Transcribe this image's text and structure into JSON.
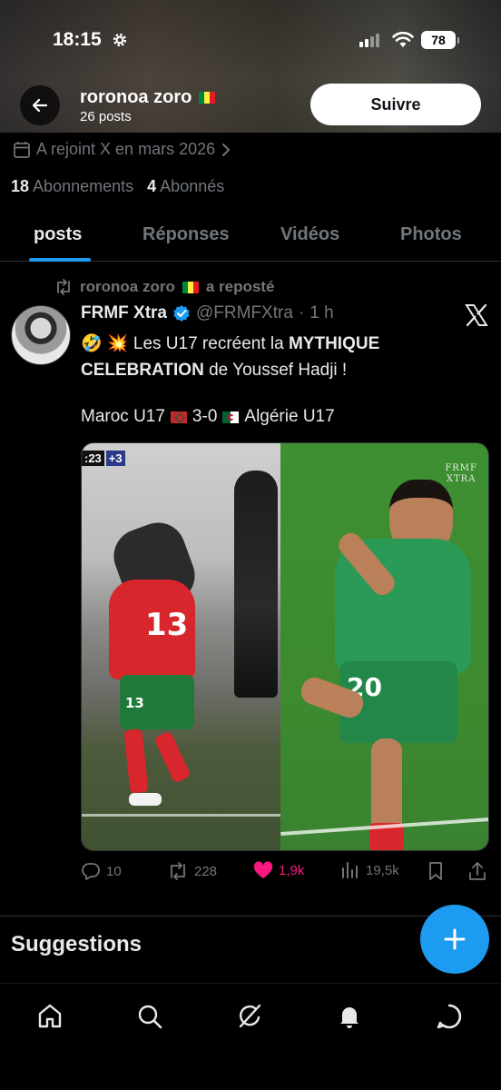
{
  "status_bar": {
    "time": "18:15",
    "battery": "78"
  },
  "header": {
    "name": "roronoa zoro",
    "posts_count": "26 posts",
    "follow_label": "Suivre"
  },
  "profile": {
    "joined": "A rejoint X en mars 2026",
    "following_count": "18",
    "following_label": "Abonnements",
    "followers_count": "4",
    "followers_label": "Abonnés"
  },
  "tabs": [
    {
      "label": "posts",
      "active": true
    },
    {
      "label": "Réponses",
      "active": false
    },
    {
      "label": "Vidéos",
      "active": false
    },
    {
      "label": "Photos",
      "active": false
    }
  ],
  "post": {
    "repost_user": "roronoa zoro",
    "repost_label": "a reposté",
    "author_name": "FRMF Xtra",
    "author_handle": "@FRMFXtra",
    "time_ago": "1 h",
    "text_emojis": "🤣 💥",
    "text_part1": "Les U17 recréent la ",
    "text_bold": "MYTHIQUE CELEBRATION",
    "text_part2": " de Youssef Hadji !",
    "score_team1": "Maroc U17",
    "score_result": "3-0",
    "score_team2": "Algérie U17",
    "media": {
      "overlay_time": ":23",
      "overlay_added": "+3",
      "watermark_line1": "FRMF",
      "watermark_line2": "XTRA",
      "jersey_left": "13",
      "jersey_left_shorts": "13",
      "jersey_right": "20"
    },
    "stats": {
      "replies": "10",
      "reposts": "228",
      "likes": "1,9k",
      "views": "19,5k"
    }
  },
  "suggestions_label": "Suggestions",
  "colors": {
    "background": "#000000",
    "accent": "#1d9bf0",
    "like": "#f91880",
    "muted_text": "#71767b",
    "primary_text": "#e7e9ea"
  },
  "icons": [
    "gear-icon",
    "back-arrow-icon",
    "calendar-icon",
    "chevron-right-icon",
    "repost-icon",
    "verified-icon",
    "x-logo-icon",
    "reply-icon",
    "heart-icon",
    "views-icon",
    "bookmark-icon",
    "share-icon",
    "plus-icon",
    "home-icon",
    "search-icon",
    "grok-icon",
    "bell-icon",
    "messages-icon"
  ]
}
